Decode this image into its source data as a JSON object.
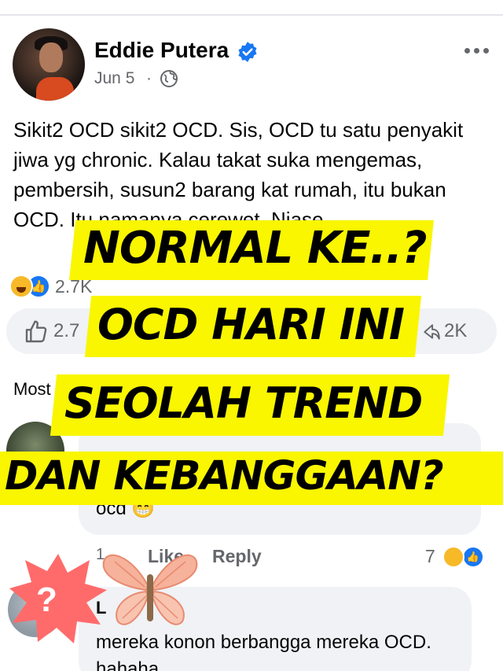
{
  "post": {
    "author": "Eddie Putera",
    "date": "Jun 5",
    "separator": "·",
    "text": "Sikit2 OCD sikit2 OCD. Sis, OCD tu satu penyakit jiwa yg chronic. Kalau takat suka mengemas, pembersih, susun2 barang kat rumah, itu bukan OCD. Itu namanya cerewet. Niase",
    "reaction_count": "2.7K",
    "like_count": "2.7",
    "share_count": "2K"
  },
  "comments_header": "Most",
  "comments": [
    {
      "text": "ocd",
      "time": "1",
      "like_label": "Like",
      "reply_label": "Reply",
      "reaction_count": "7"
    },
    {
      "name": "L",
      "text": "mereka konon berbangga mereka OCD. hahaha"
    }
  ],
  "overlay": {
    "line1": "NORMAL KE..?",
    "line2": "OCD HARI INI",
    "line3": "SEOLAH TREND",
    "line4": "DAN KEBANGGAAN?",
    "highlight_color": "#f9f600"
  },
  "stickers": {
    "question": "?"
  },
  "icons": {
    "verified": "verified-badge-icon",
    "globe": "globe-icon",
    "more": "more-options-icon",
    "like": "thumbs-up-icon",
    "share": "share-icon"
  },
  "colors": {
    "facebook_blue": "#1877f2",
    "secondary_text": "#65676b",
    "bubble": "#f0f2f5"
  }
}
